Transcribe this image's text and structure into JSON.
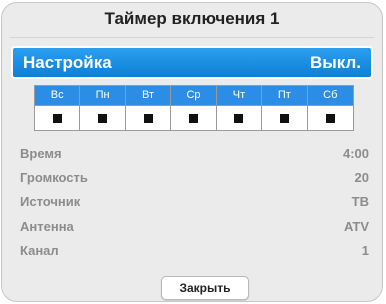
{
  "dialog": {
    "title": "Таймер включения 1",
    "setting": {
      "label": "Настройка",
      "value": "Выкл."
    },
    "days": [
      {
        "label": "Вс",
        "checked": true
      },
      {
        "label": "Пн",
        "checked": true
      },
      {
        "label": "Вт",
        "checked": true
      },
      {
        "label": "Ср",
        "checked": true
      },
      {
        "label": "Чт",
        "checked": true
      },
      {
        "label": "Пт",
        "checked": true
      },
      {
        "label": "Сб",
        "checked": true
      }
    ],
    "rows": [
      {
        "label": "Время",
        "value": "4:00"
      },
      {
        "label": "Громкость",
        "value": "20"
      },
      {
        "label": "Источник",
        "value": "ТВ"
      },
      {
        "label": "Антенна",
        "value": "ATV"
      },
      {
        "label": "Канал",
        "value": "1"
      }
    ],
    "close_label": "Закрыть"
  },
  "colors": {
    "highlight": "#1a8ce6",
    "day_header": "#2b8de6",
    "disabled_text": "#8c8c8c"
  }
}
